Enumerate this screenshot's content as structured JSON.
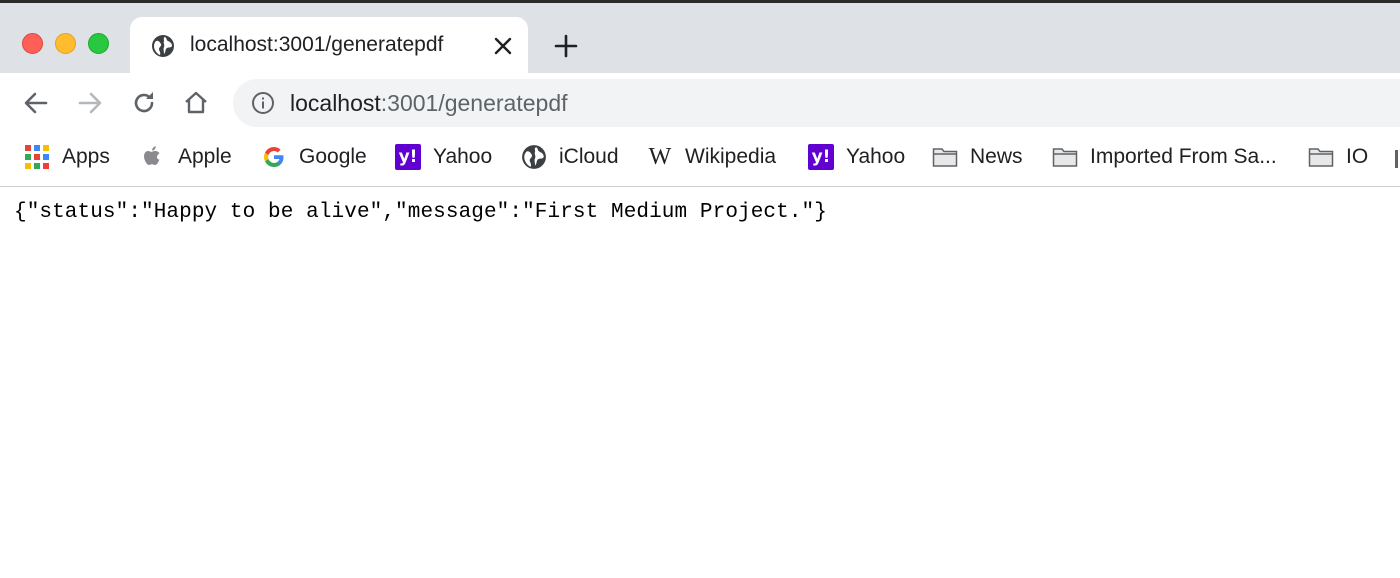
{
  "window": {
    "buttons": [
      "close",
      "minimize",
      "zoom"
    ]
  },
  "tab": {
    "title": "localhost:3001/generatepdf",
    "favicon": "globe-icon"
  },
  "omnibox": {
    "host": "localhost",
    "rest": ":3001/generatepdf"
  },
  "bookmarks": [
    {
      "label": "Apps",
      "icon": "apps-grid-icon"
    },
    {
      "label": "Apple",
      "icon": "apple-icon"
    },
    {
      "label": "Google",
      "icon": "google-icon"
    },
    {
      "label": "Yahoo",
      "icon": "yahoo-icon"
    },
    {
      "label": "iCloud",
      "icon": "globe-icon"
    },
    {
      "label": "Wikipedia",
      "icon": "wikipedia-icon"
    },
    {
      "label": "Yahoo",
      "icon": "yahoo-icon"
    },
    {
      "label": "News",
      "icon": "folder-icon"
    },
    {
      "label": "Imported From Sa...",
      "icon": "folder-icon"
    },
    {
      "label": "IO",
      "icon": "folder-icon"
    }
  ],
  "page": {
    "body_text": "{\"status\":\"Happy to be alive\",\"message\":\"First Medium Project.\"}"
  },
  "colors": {
    "tabstrip": "#dee1e6",
    "omnibox": "#f1f3f4",
    "yahoo": "#6001d2"
  }
}
